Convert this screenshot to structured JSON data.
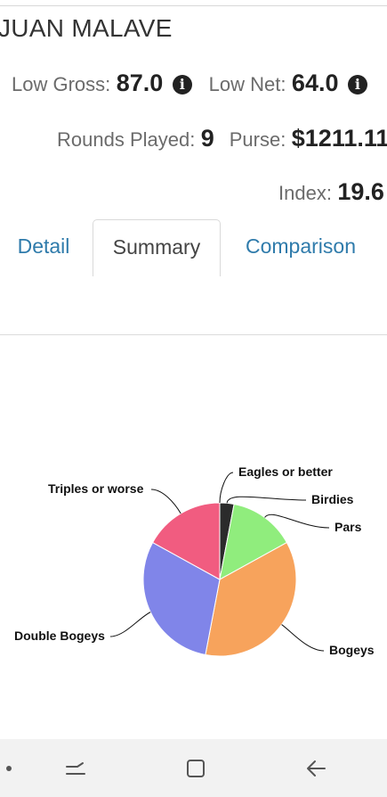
{
  "player": {
    "name": "JUAN MALAVE"
  },
  "stats": {
    "low_gross": {
      "label": "Low Gross:",
      "value": "87.0"
    },
    "low_net": {
      "label": "Low Net:",
      "value": "64.0"
    },
    "rounds_played": {
      "label": "Rounds Played:",
      "value": "9"
    },
    "purse": {
      "label": "Purse:",
      "value": "$1211.11"
    },
    "index": {
      "label": "Index:",
      "value": "19.6"
    }
  },
  "tabs": [
    {
      "label": "Detail",
      "active": false
    },
    {
      "label": "Summary",
      "active": true
    },
    {
      "label": "Comparison",
      "active": false
    }
  ],
  "chart_data": {
    "type": "pie",
    "slices": [
      {
        "label": "Eagles or better",
        "value": 0,
        "color": "#222222"
      },
      {
        "label": "Birdies",
        "value": 3,
        "color": "#2b2b2b"
      },
      {
        "label": "Pars",
        "value": 14,
        "color": "#90ed7d"
      },
      {
        "label": "Bogeys",
        "value": 36,
        "color": "#f7a35c"
      },
      {
        "label": "Double Bogeys",
        "value": 30,
        "color": "#8085e9"
      },
      {
        "label": "Triples or worse",
        "value": 17,
        "color": "#f15c80"
      }
    ]
  },
  "nav": {
    "icons": [
      "dot-icon",
      "recent-apps-icon",
      "home-icon",
      "back-icon"
    ]
  }
}
